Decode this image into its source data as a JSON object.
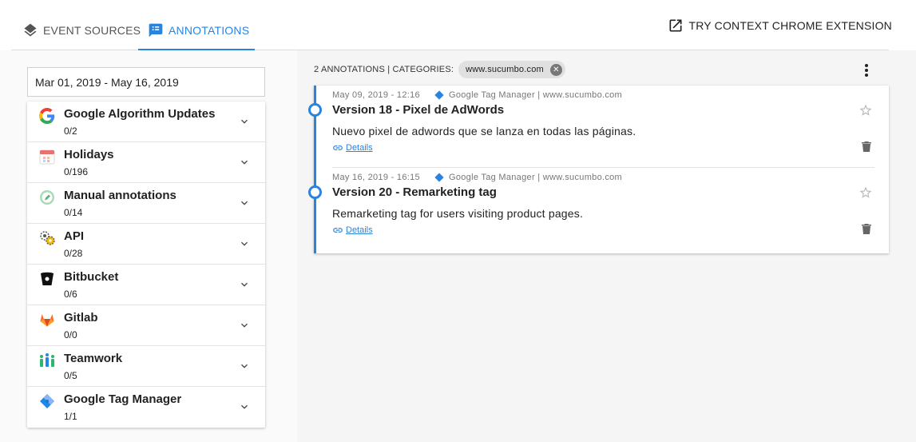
{
  "tabs": {
    "event_sources": "EVENT SOURCES",
    "annotations": "ANNOTATIONS"
  },
  "extension_link": "TRY CONTEXT CHROME EXTENSION",
  "date_range": "Mar 01, 2019 - May 16, 2019",
  "sources": [
    {
      "name": "Google Algorithm Updates",
      "count": "0/2",
      "icon": "google-icon"
    },
    {
      "name": "Holidays",
      "count": "0/196",
      "icon": "calendar-icon"
    },
    {
      "name": "Manual annotations",
      "count": "0/14",
      "icon": "pencil-icon"
    },
    {
      "name": "API",
      "count": "0/28",
      "icon": "api-gears-icon"
    },
    {
      "name": "Bitbucket",
      "count": "0/6",
      "icon": "bitbucket-icon"
    },
    {
      "name": "Gitlab",
      "count": "0/0",
      "icon": "gitlab-icon"
    },
    {
      "name": "Teamwork",
      "count": "0/5",
      "icon": "teamwork-icon"
    },
    {
      "name": "Google Tag Manager",
      "count": "1/1",
      "icon": "gtm-icon"
    }
  ],
  "filter_bar": {
    "summary": "2 ANNOTATIONS | CATEGORIES:",
    "chip": "www.sucumbo.com"
  },
  "annotations": [
    {
      "date": "May 09, 2019 - 12:16",
      "source": "Google Tag Manager | www.sucumbo.com",
      "title": "Version 18 - Pixel de AdWords",
      "description": "Nuevo pixel de adwords que se lanza en todas las páginas.",
      "details": "Details"
    },
    {
      "date": "May 16, 2019 - 16:15",
      "source": "Google Tag Manager | www.sucumbo.com",
      "title": "Version 20 - Remarketing tag",
      "description": "Remarketing tag for users visiting product pages.",
      "details": "Details"
    }
  ],
  "colors": {
    "accent": "#2a84de",
    "divider": "#dddddd",
    "panel_bg": "#f5f5f5"
  }
}
